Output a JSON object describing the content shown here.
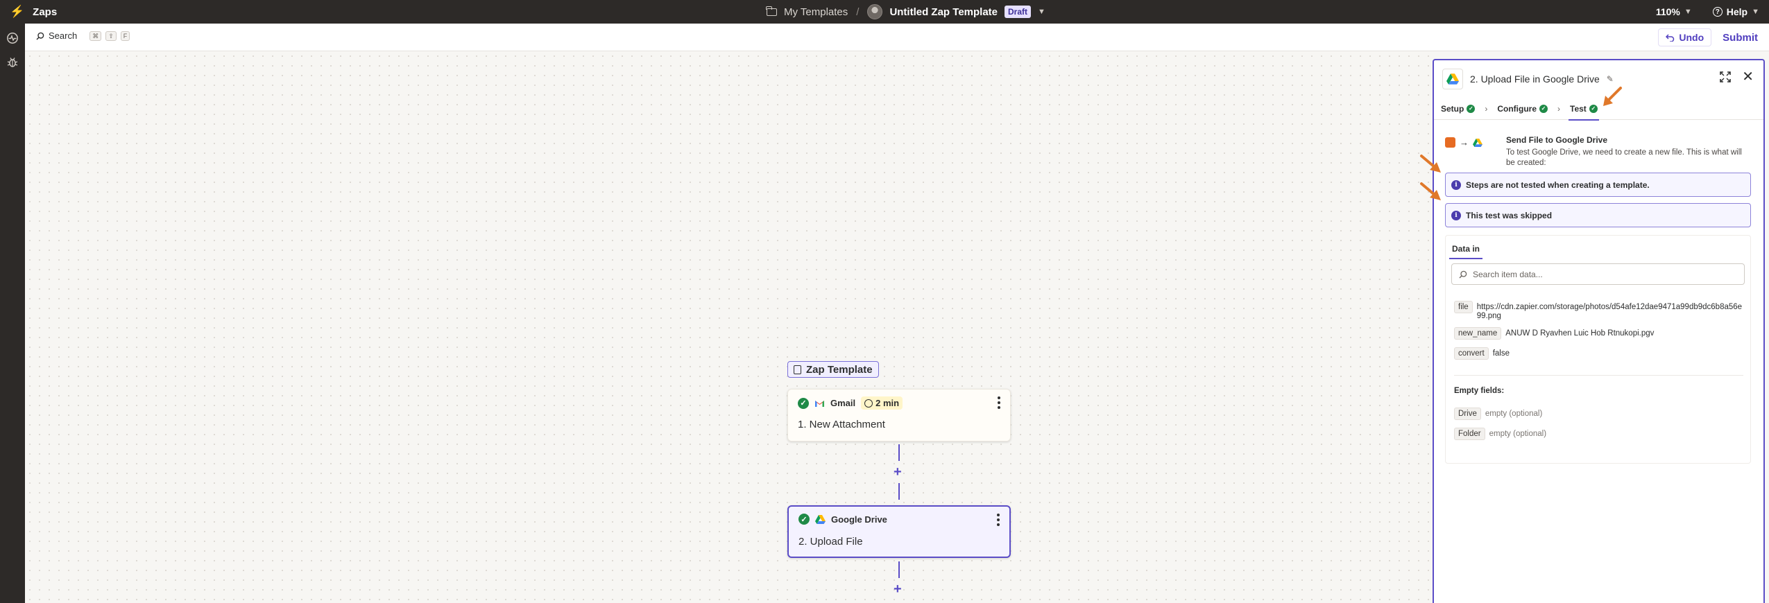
{
  "topbar": {
    "brand": "Zaps",
    "breadcrumb_folder": "My Templates",
    "separator": "/",
    "zap_name": "Untitled Zap Template",
    "status_badge": "Draft",
    "zoom": "110%",
    "help": "Help"
  },
  "toolbar": {
    "search_label": "Search",
    "search_shortcut": [
      "⌘",
      "⇧",
      "F"
    ],
    "undo_label": "Undo",
    "submit_label": "Submit"
  },
  "canvas": {
    "template_label": "Zap Template",
    "steps": [
      {
        "app": "Gmail",
        "timer": "2 min",
        "title": "1. New Attachment"
      },
      {
        "app": "Google Drive",
        "title": "2. Upload File"
      }
    ]
  },
  "panel": {
    "title": "2. Upload File in Google Drive",
    "tabs": [
      "Setup",
      "Configure",
      "Test"
    ],
    "send_title": "Send File to Google Drive",
    "send_desc": "To test Google Drive, we need to create a new file. This is what will be created:",
    "info_1": "Steps are not tested when creating a template.",
    "info_2": "This test was skipped",
    "data_tab": "Data in",
    "search_placeholder": "Search item data...",
    "fields": [
      {
        "key": "file",
        "value": "https://cdn.zapier.com/storage/photos/d54afe12dae9471a99db9dc6b8a56e99.png"
      },
      {
        "key": "new_name",
        "value": "ANUW D Ryavhen Luic Hob Rtnukopi.pgv"
      },
      {
        "key": "convert",
        "value": "false"
      }
    ],
    "empty_heading": "Empty fields:",
    "empty_fields": [
      {
        "key": "Drive",
        "value": "empty (optional)"
      },
      {
        "key": "Folder",
        "value": "empty (optional)"
      }
    ]
  },
  "colors": {
    "accent": "#5b4dc7",
    "topbar_bg": "#2d2a28",
    "success": "#1f8a47",
    "annotation_arrow": "#e0782a"
  },
  "icons": [
    "zapier-bolt-icon",
    "folder-icon",
    "chevron-down-icon",
    "help-icon",
    "activity-icon",
    "bug-icon",
    "search-icon",
    "undo-icon",
    "document-icon",
    "gmail-icon",
    "google-drive-icon",
    "clock-icon",
    "more-vertical-icon",
    "check-icon",
    "pencil-icon",
    "expand-icon",
    "close-icon",
    "info-icon"
  ]
}
